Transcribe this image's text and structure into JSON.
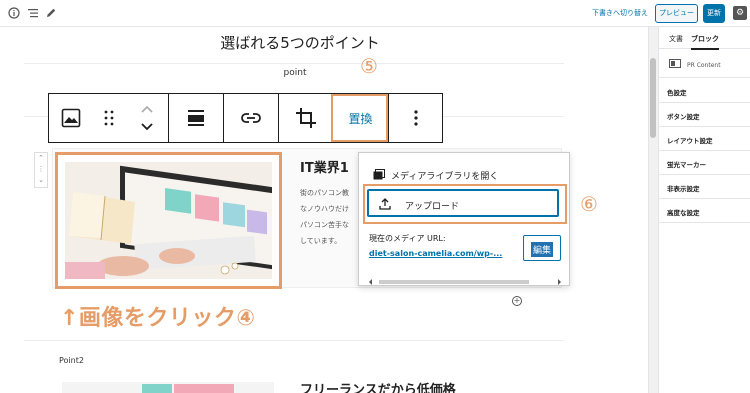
{
  "topbar": {
    "switch_link": "下書きへ切り替え",
    "preview_label": "プレビュー",
    "update_label": "更新"
  },
  "editor": {
    "heading": "選ばれる5つのポイント",
    "point_label": "point",
    "article_title": "IT業界1",
    "article_lines": [
      "街のパソコン教",
      "なノウハウだけ",
      "パソコン苦手な",
      "しています。"
    ],
    "point2_label": "Point2",
    "bottom_title": "フリーランスだから低価格"
  },
  "toolbar": {
    "replace_label": "置換"
  },
  "popover": {
    "open_library": "メディアライブラリを開く",
    "upload": "アップロード",
    "current_url_label": "現在のメディア URL:",
    "current_url": "diet-salon-camelia.com/wp-...",
    "edit": "編集"
  },
  "annotations": {
    "click_image": "↑画像をクリック④",
    "num5": "⑤",
    "num6": "⑥"
  },
  "sidebar": {
    "tab_document": "文書",
    "tab_block": "ブロック",
    "block_name": "PR Content",
    "items": [
      "色設定",
      "ボタン設定",
      "レイアウト設定",
      "蛍光マーカー",
      "非表示設定",
      "高度な設定"
    ]
  },
  "colors": {
    "accent": "#e69c66",
    "wp_blue": "#0073aa"
  }
}
